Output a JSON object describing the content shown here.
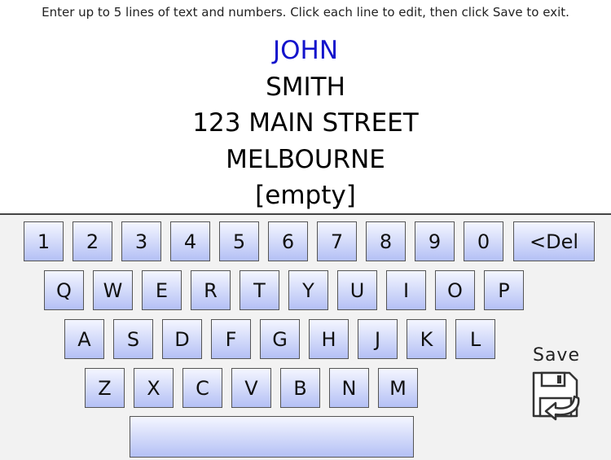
{
  "instructions": "Enter up to 5 lines of text and numbers. Click each line to edit, then click Save to exit.",
  "lines": [
    "JOHN",
    "SMITH",
    "123 MAIN STREET",
    "MELBOURNE",
    "[empty]"
  ],
  "active_line": 0,
  "colors": {
    "active_text": "#1414cc",
    "key_top": "#f4f6ff",
    "key_bottom": "#b4c0f5"
  },
  "keyboard": {
    "row1": [
      "1",
      "2",
      "3",
      "4",
      "5",
      "6",
      "7",
      "8",
      "9",
      "0",
      "<Del"
    ],
    "row2": [
      "Q",
      "W",
      "E",
      "R",
      "T",
      "Y",
      "U",
      "I",
      "O",
      "P"
    ],
    "row3": [
      "A",
      "S",
      "D",
      "F",
      "G",
      "H",
      "J",
      "K",
      "L"
    ],
    "row4": [
      "Z",
      "X",
      "C",
      "V",
      "B",
      "N",
      "M"
    ],
    "space": ""
  },
  "save": {
    "label": "Save",
    "icon": "save-floppy-icon"
  }
}
